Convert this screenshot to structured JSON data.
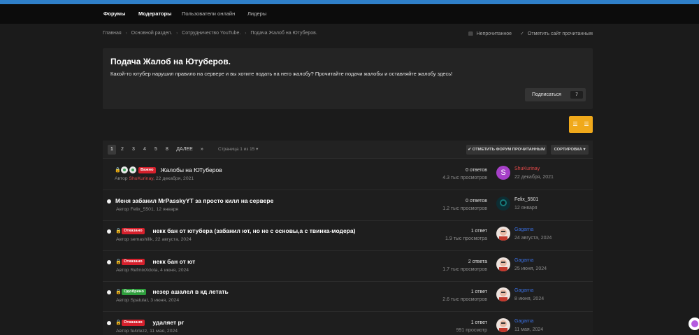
{
  "nav": {
    "items": [
      {
        "label": "Форумы",
        "bold": true
      },
      {
        "label": "Модераторы",
        "bold": true
      },
      {
        "label": "Пользователи онлайн",
        "bold": false
      },
      {
        "label": "Лидеры",
        "bold": false
      }
    ]
  },
  "breadcrumb": {
    "items": [
      "Главная",
      "Основной раздел.",
      "Сотрудничество YouTube.",
      "Подача Жалоб на Ютуберов."
    ],
    "unread_label": "Непрочитанное",
    "mark_site_read_label": "Отметить сайт прочитанным"
  },
  "forum": {
    "title": "Подача Жалоб на Ютуберов.",
    "description": "Какой-то ютубер нарушил правило на сервере и вы хотите подать на него жалобу? Прочитайте подачи жалобы и оставляйте жалобу здесь!",
    "subscribe_label": "Подписаться",
    "subscribe_count": "7"
  },
  "pagination": {
    "pages": [
      "1",
      "2",
      "3",
      "4",
      "5",
      "8"
    ],
    "next_label": "ДАЛЕЕ",
    "last_label": "»",
    "page_info": "Страница 1 из 15",
    "mark_forum_read_label": "✔ ОТМЕТИТЬ ФОРУМ ПРОЧИТАННЫМ",
    "sort_label": "СОРТИРОВКА ▾"
  },
  "topics": [
    {
      "unread": false,
      "locked": true,
      "pinned_badges": true,
      "tag": "Важно",
      "tag_color": "red",
      "title": "Жалобы на ЮТуберов",
      "title_bold": false,
      "author_prefix": "Автор ",
      "author": "ShuKurinay",
      "author_color": "red",
      "date": ", 22 декабря, 2021",
      "answers": "0 ответов",
      "views": "4.3 тыс просмотров",
      "last_poster": "ShuKurinay",
      "last_poster_color": "red",
      "last_date": "22 декабря, 2021",
      "avatar_type": "letter",
      "avatar_letter": "S"
    },
    {
      "unread": true,
      "locked": false,
      "pinned_badges": false,
      "tag": "",
      "tag_color": "",
      "title": "Меня забанил MrPasskyYT за просто килл на сервере",
      "title_bold": true,
      "author_prefix": "Автор ",
      "author": "Felix_5501",
      "author_color": "gray",
      "date": ", 12 января",
      "answers": "0 ответов",
      "views": "1.2 тыс просмотров",
      "last_poster": "Felix_5501",
      "last_poster_color": "white",
      "last_date": "12 января",
      "avatar_type": "dark",
      "avatar_letter": ""
    },
    {
      "unread": true,
      "locked": true,
      "pinned_badges": false,
      "tag": "Отказано",
      "tag_color": "red",
      "title": "некк бан от ютубера (забанил ют, но не с основы,а с твинка-модера)",
      "title_bold": true,
      "author_prefix": "Автор ",
      "author": "semashilik",
      "author_color": "gray",
      "date": ", 22 августа, 2024",
      "answers": "1 ответ",
      "views": "1.9 тыс просмотра",
      "last_poster": "Gagarna",
      "last_poster_color": "blue",
      "last_date": "24 августа, 2024",
      "avatar_type": "face",
      "avatar_letter": ""
    },
    {
      "unread": true,
      "locked": true,
      "pinned_badges": false,
      "tag": "Отказано",
      "tag_color": "red",
      "title": "некк бан от ют",
      "title_bold": true,
      "author_prefix": "Автор ",
      "author": "RefmixXdota",
      "author_color": "gray",
      "date": ", 4 июня, 2024",
      "answers": "2 ответа",
      "views": "1.7 тыс просмотров",
      "last_poster": "Gagarna",
      "last_poster_color": "blue",
      "last_date": "25 июня, 2024",
      "avatar_type": "face",
      "avatar_letter": ""
    },
    {
      "unread": true,
      "locked": true,
      "pinned_badges": false,
      "tag": "Одобрено",
      "tag_color": "green",
      "title": "незер ашалел в кд летать",
      "title_bold": true,
      "author_prefix": "Автор ",
      "author": "Spatulat",
      "author_color": "gray",
      "date": ", 3 июня, 2024",
      "answers": "1 ответ",
      "views": "2.6 тыс просмотров",
      "last_poster": "Gagarna",
      "last_poster_color": "blue",
      "last_date": "8 июня, 2024",
      "avatar_type": "face",
      "avatar_letter": ""
    },
    {
      "unread": true,
      "locked": true,
      "pinned_badges": false,
      "tag": "Отказано",
      "tag_color": "red",
      "title": "удаляет рг",
      "title_bold": true,
      "author_prefix": "Автор ",
      "author": "fe4rlezz",
      "author_color": "gray",
      "date": ", 11 мая, 2024",
      "answers": "1 ответ",
      "views": "991 просмотр",
      "last_poster": "Gagarna",
      "last_poster_color": "blue",
      "last_date": "11 мая, 2024",
      "avatar_type": "face",
      "avatar_letter": ""
    }
  ]
}
